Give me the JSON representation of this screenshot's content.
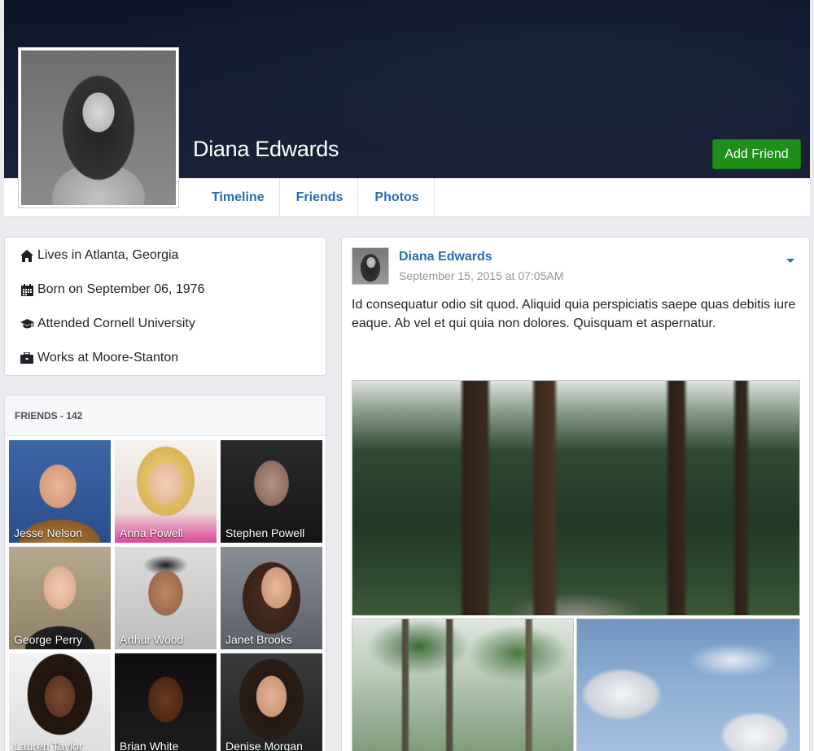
{
  "profile": {
    "name": "Diana Edwards",
    "add_friend_label": "Add Friend"
  },
  "tabs": [
    {
      "label": "Timeline"
    },
    {
      "label": "Friends"
    },
    {
      "label": "Photos"
    }
  ],
  "intro": {
    "items": [
      {
        "icon": "home-icon",
        "text": "Lives in Atlanta, Georgia"
      },
      {
        "icon": "calendar-icon",
        "text": "Born on September 06, 1976"
      },
      {
        "icon": "graduation-cap-icon",
        "text": "Attended Cornell University"
      },
      {
        "icon": "briefcase-icon",
        "text": "Works at Moore-Stanton"
      }
    ]
  },
  "friends": {
    "heading": "FRIENDS - 142",
    "list": [
      {
        "name": "Jesse Nelson"
      },
      {
        "name": "Anna Powell"
      },
      {
        "name": "Stephen Powell"
      },
      {
        "name": "George Perry"
      },
      {
        "name": "Arthur Wood"
      },
      {
        "name": "Janet Brooks"
      },
      {
        "name": "Lauren Taylor"
      },
      {
        "name": "Brian White"
      },
      {
        "name": "Denise Morgan"
      }
    ]
  },
  "post": {
    "author": "Diana Edwards",
    "timestamp": "September 15, 2015 at 07:05AM",
    "text": "Id consequatur odio sit quod. Aliquid quia perspiciatis saepe quas debitis iure eaque. Ab vel et qui quia non dolores. Quisquam et aspernatur."
  },
  "colors": {
    "link": "#2b6cb0",
    "add_friend": "#1f8f1a",
    "cover": "#141d33"
  }
}
